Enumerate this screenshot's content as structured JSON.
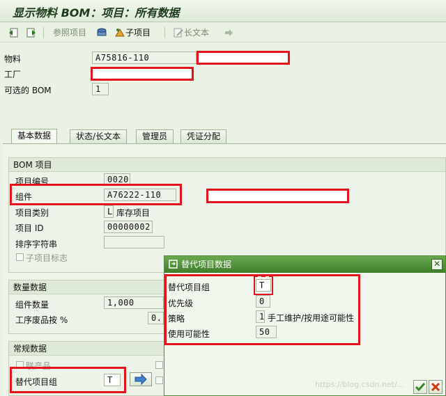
{
  "window": {
    "title": "显示物料 BOM：项目：所有数据"
  },
  "toolbar": {
    "ref_item": "参照项目",
    "sub_item": "子项目",
    "long_text": "长文本"
  },
  "header": {
    "material_label": "物料",
    "material_value": "A75816-110",
    "plant_label": "工厂",
    "alt_bom_label": "可选的 BOM",
    "alt_bom_value": "1"
  },
  "tabs": [
    {
      "label": "基本数据",
      "selected": true
    },
    {
      "label": "状态/长文本",
      "selected": false
    },
    {
      "label": "管理员",
      "selected": false
    },
    {
      "label": "凭证分配",
      "selected": false
    }
  ],
  "bom_item": {
    "title": "BOM 项目",
    "item_no_label": "项目编号",
    "item_no_value": "0020",
    "component_label": "组件",
    "component_value": "A76222-110",
    "category_label": "项目类别",
    "category_code": "L",
    "category_text": "库存项目",
    "item_id_label": "项目 ID",
    "item_id_value": "00000002",
    "sort_label": "排序字符串",
    "sub_item_indicator": "子项目标志"
  },
  "quantity": {
    "title": "数量数据",
    "comp_qty_label": "组件数量",
    "comp_qty_value": "1,000",
    "scrap_label": "工序废品按 %",
    "scrap_value": "0."
  },
  "general": {
    "title": "常规数据",
    "co_product": "联产品",
    "alt_group_label": "替代项目组",
    "alt_group_value": "T"
  },
  "dialog": {
    "title": "替代项目数据",
    "alt_group_label": "替代项目组",
    "alt_group_value": "T",
    "priority_label": "优先级",
    "priority_value": "0",
    "strategy_label": "策略",
    "strategy_value": "1",
    "strategy_text": "手工维护/按用途可能性",
    "usage_label": "使用可能性",
    "usage_value": "50"
  },
  "watermark": "https://blog.csdn.net/...",
  "colors": {
    "annotation_red": "#e3141b",
    "dialog_header": "#3f7f2b"
  }
}
